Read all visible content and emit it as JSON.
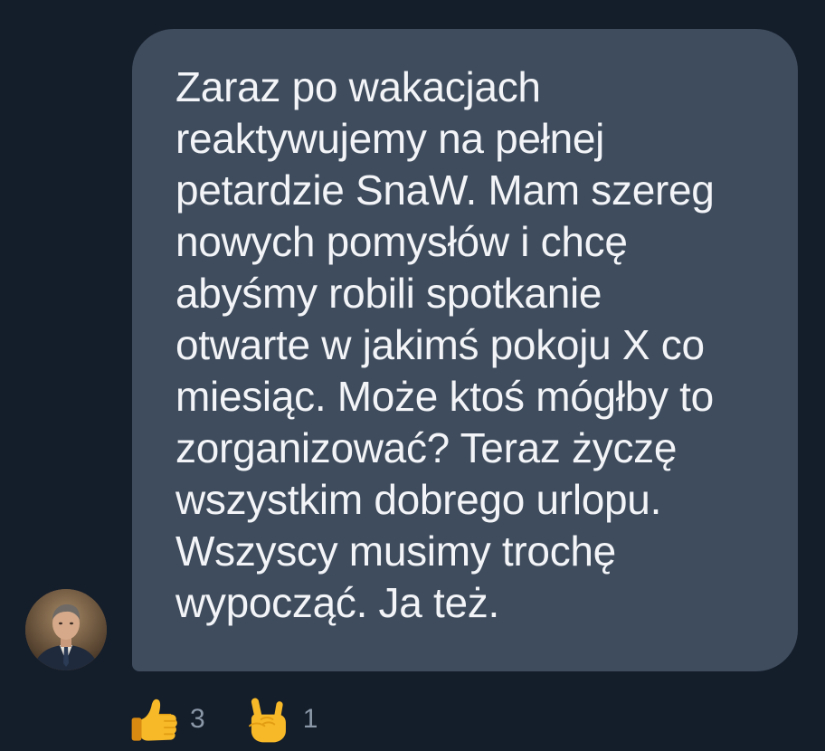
{
  "message": {
    "lines": [
      "Zaraz po wakacjach",
      "reaktywujemy na pełnej",
      "petardzie SnaW. Mam szereg",
      "nowych pomysłów i chcę",
      "abyśmy robili spotkanie",
      "otwarte w jakimś pokoju X co",
      "miesiąc. Może ktoś mógłby to",
      "zorganizować? Teraz życzę",
      "wszystkim dobrego urlopu.",
      "Wszyscy musimy trochę",
      "wypocząć. Ja też."
    ]
  },
  "reactions": [
    {
      "emoji": "thumbs-up-icon",
      "count": "3"
    },
    {
      "emoji": "sign-of-horns-icon",
      "count": "1"
    }
  ],
  "colors": {
    "background": "#141d2a",
    "bubble": "#3f4c5d",
    "text": "#f2f4f7",
    "count": "#8b98a7",
    "emoji_yellow": "#f7b928"
  }
}
